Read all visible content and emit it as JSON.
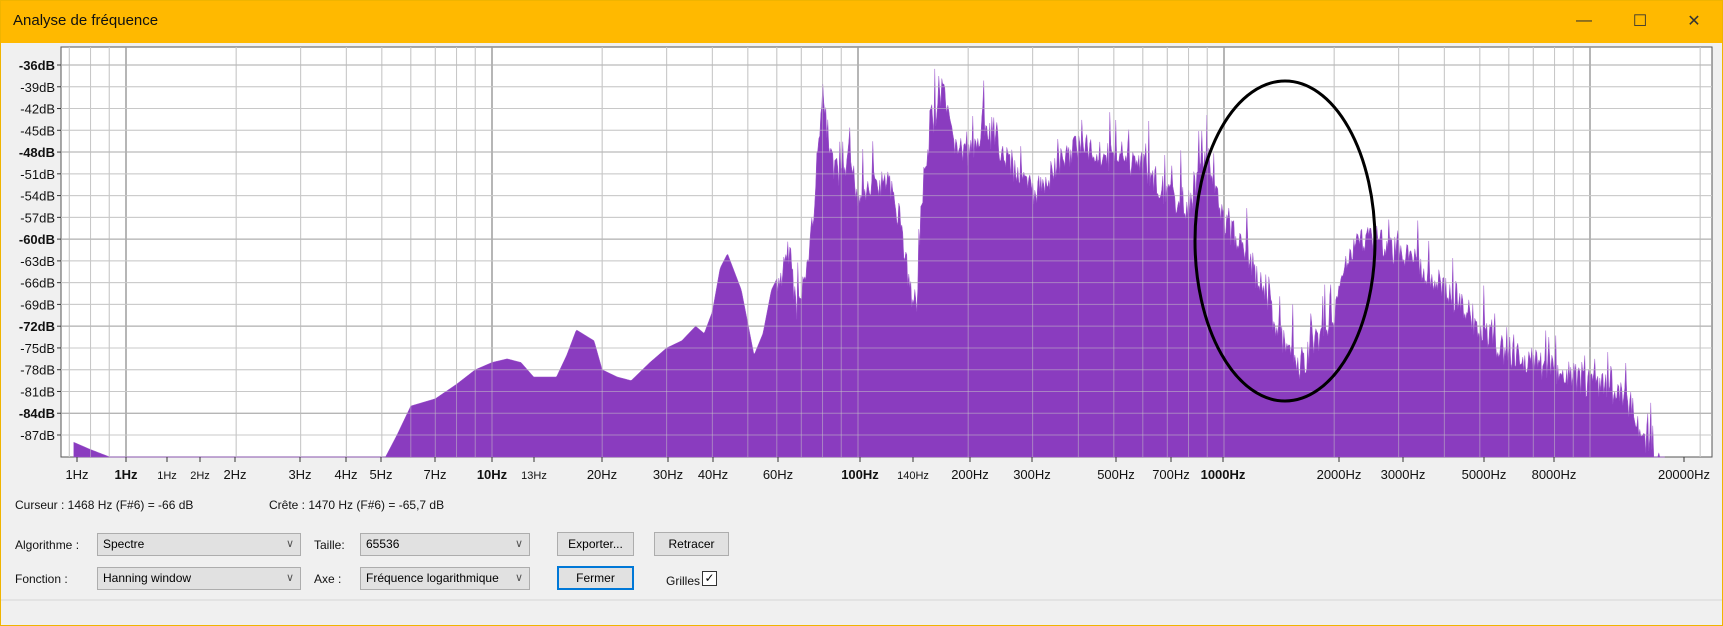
{
  "window": {
    "title": "Analyse de fréquence",
    "minimize": "—",
    "maximize": "☐",
    "close": "✕"
  },
  "chart_data": {
    "type": "area",
    "title": "Analyse de fréquence",
    "xscale": "log",
    "xlim": [
      0.72,
      22000
    ],
    "ylim": [
      -91,
      -33
    ],
    "y_ticks": [
      "-36dB",
      "-39dB",
      "-42dB",
      "-45dB",
      "-48dB",
      "-51dB",
      "-54dB",
      "-57dB",
      "-60dB",
      "-63dB",
      "-66dB",
      "-69dB",
      "-72dB",
      "-75dB",
      "-78dB",
      "-81dB",
      "-84dB",
      "-87dB"
    ],
    "y_tick_values": [
      -36,
      -39,
      -42,
      -45,
      -48,
      -51,
      -54,
      -57,
      -60,
      -63,
      -66,
      -69,
      -72,
      -75,
      -78,
      -81,
      -84,
      -87
    ],
    "x_ticks": [
      "1Hz",
      "1Hz",
      "1Hz",
      "2Hz",
      "2Hz",
      "3Hz",
      "4Hz",
      "5Hz",
      "7Hz",
      "10Hz",
      "13Hz",
      "20Hz",
      "30Hz",
      "40Hz",
      "60Hz",
      "100Hz",
      "140Hz",
      "200Hz",
      "300Hz",
      "500Hz",
      "700Hz",
      "1000Hz",
      "2000Hz",
      "3000Hz",
      "5000Hz",
      "8000Hz",
      "20000Hz"
    ],
    "color": "#8a3cbf",
    "points": [
      [
        0.72,
        -88
      ],
      [
        0.8,
        -89
      ],
      [
        0.9,
        -90
      ],
      [
        1.0,
        -91
      ],
      [
        1.1,
        -91.5
      ],
      [
        4.9,
        -91.5
      ],
      [
        5,
        -91
      ],
      [
        5.5,
        -87
      ],
      [
        6,
        -83
      ],
      [
        7,
        -82
      ],
      [
        8,
        -80
      ],
      [
        9,
        -78
      ],
      [
        10,
        -77
      ],
      [
        11,
        -76.5
      ],
      [
        12,
        -77
      ],
      [
        13,
        -79
      ],
      [
        15,
        -79
      ],
      [
        16,
        -76
      ],
      [
        17,
        -72.5
      ],
      [
        19,
        -74
      ],
      [
        20,
        -78
      ],
      [
        22,
        -79
      ],
      [
        24,
        -79.5
      ],
      [
        27,
        -77
      ],
      [
        30,
        -75
      ],
      [
        33,
        -74
      ],
      [
        36,
        -72
      ],
      [
        38,
        -73
      ],
      [
        40,
        -70
      ],
      [
        42,
        -64
      ],
      [
        44,
        -62
      ],
      [
        48,
        -67
      ],
      [
        52,
        -76
      ],
      [
        55,
        -73
      ],
      [
        58,
        -67
      ],
      [
        62,
        -64
      ],
      [
        65,
        -59
      ],
      [
        68,
        -68
      ],
      [
        72,
        -63
      ],
      [
        75,
        -56
      ],
      [
        80,
        -38
      ],
      [
        85,
        -48
      ],
      [
        90,
        -50
      ],
      [
        95,
        -47
      ],
      [
        100,
        -52
      ],
      [
        110,
        -51
      ],
      [
        120,
        -50
      ],
      [
        130,
        -55
      ],
      [
        140,
        -66
      ],
      [
        145,
        -67
      ],
      [
        150,
        -52
      ],
      [
        160,
        -42
      ],
      [
        170,
        -37
      ],
      [
        180,
        -44
      ],
      [
        200,
        -47
      ],
      [
        220,
        -43
      ],
      [
        250,
        -46
      ],
      [
        300,
        -52
      ],
      [
        350,
        -48
      ],
      [
        400,
        -45
      ],
      [
        500,
        -47
      ],
      [
        600,
        -48
      ],
      [
        700,
        -52
      ],
      [
        800,
        -54
      ],
      [
        900,
        -46
      ],
      [
        1000,
        -56
      ],
      [
        1100,
        -58
      ],
      [
        1300,
        -66
      ],
      [
        1470,
        -73
      ],
      [
        1600,
        -76
      ],
      [
        1800,
        -72
      ],
      [
        2000,
        -68
      ],
      [
        2200,
        -60
      ],
      [
        2500,
        -57
      ],
      [
        3000,
        -60
      ],
      [
        3500,
        -62
      ],
      [
        4000,
        -65
      ],
      [
        5000,
        -70
      ],
      [
        6000,
        -74
      ],
      [
        7000,
        -75
      ],
      [
        8000,
        -76
      ],
      [
        10000,
        -78
      ],
      [
        12000,
        -79
      ],
      [
        13000,
        -81
      ],
      [
        14000,
        -85
      ],
      [
        15000,
        -88
      ],
      [
        16000,
        -91
      ]
    ]
  },
  "status": {
    "cursor": "Curseur : 1468 Hz (F#6) = -66 dB",
    "peak": "Crête : 1470 Hz (F#6) = -65,7 dB"
  },
  "controls": {
    "algorithm_label": "Algorithme :",
    "algorithm_value": "Spectre",
    "size_label": "Taille:",
    "size_value": "65536",
    "function_label": "Fonction :",
    "function_value": "Hanning window",
    "axis_label": "Axe :",
    "axis_value": "Fréquence logarithmique",
    "export": "Exporter...",
    "redraw": "Retracer",
    "close": "Fermer",
    "grids_label": "Grilles",
    "grids_checked": true,
    "check": "✓",
    "chevron": "∨"
  }
}
